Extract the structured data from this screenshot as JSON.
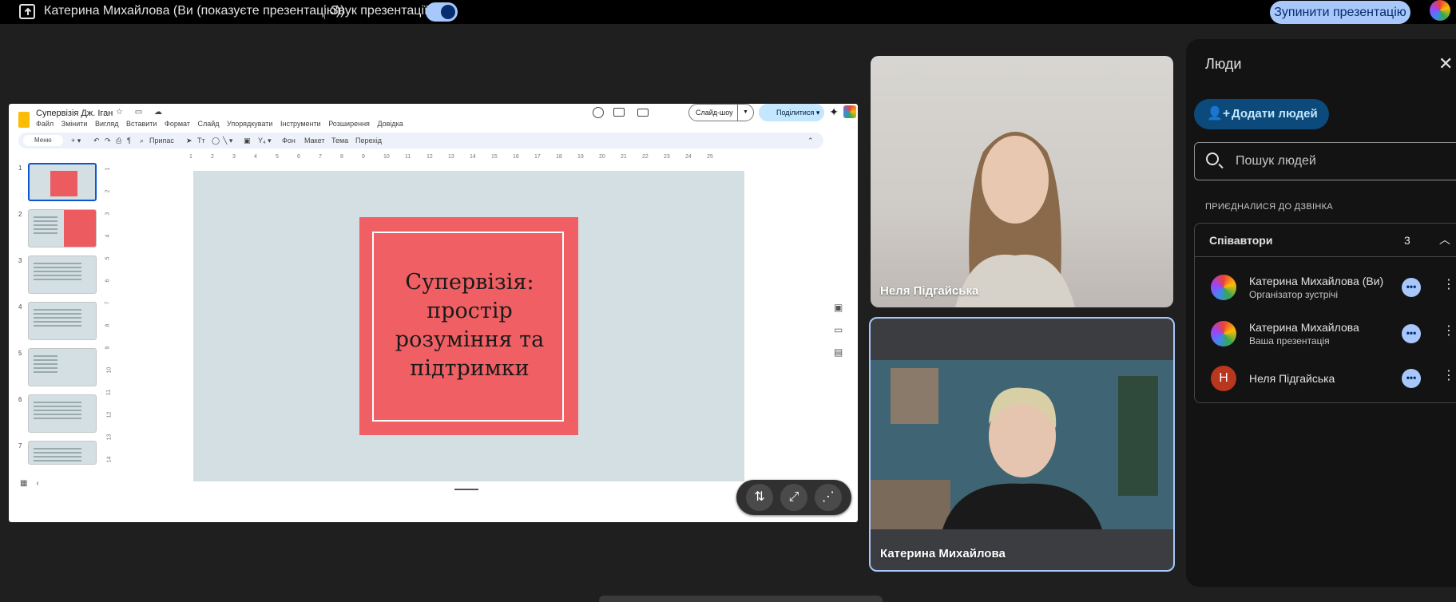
{
  "topbar": {
    "presenter_title": "Катерина Михайлова (Ви (показуєте презентацію))",
    "audio_label": "Звук презентації",
    "stop_button": "Зупинити презентацію"
  },
  "slides_app": {
    "doc_title": "Супервізія Дж. Іган",
    "menu": [
      "Файл",
      "Змінити",
      "Вигляд",
      "Вставити",
      "Формат",
      "Слайд",
      "Упорядкувати",
      "Інструменти",
      "Розширення",
      "Довідка"
    ],
    "slideshow_label": "Слайд-шоу",
    "share_label": "Поділитися",
    "toolbar": {
      "search": "Меню",
      "zoom": "Припас",
      "background": "Фон",
      "layout": "Макет",
      "theme": "Тема",
      "transition": "Перехід"
    },
    "ruler_h": [
      "1",
      "2",
      "3",
      "4",
      "5",
      "6",
      "7",
      "8",
      "9",
      "10",
      "11",
      "12",
      "13",
      "14",
      "15",
      "16",
      "17",
      "18",
      "19",
      "20",
      "21",
      "22",
      "23",
      "24",
      "25"
    ],
    "ruler_v": [
      "1",
      "2",
      "3",
      "4",
      "5",
      "6",
      "7",
      "8",
      "9",
      "10",
      "11",
      "12",
      "13",
      "14"
    ],
    "slide_numbers": [
      "1",
      "2",
      "3",
      "4",
      "5",
      "6",
      "7"
    ],
    "current_slide_title": "Супервізія: простір розуміння та підтримки",
    "colors": {
      "slide_bg": "#d3dfe3",
      "slide_accent": "#ef5f63"
    }
  },
  "participants": [
    {
      "name": "Неля Підгайська"
    },
    {
      "name": "Катерина Михайлова"
    }
  ],
  "people_panel": {
    "title": "Люди",
    "add_button": "Додати людей",
    "search_placeholder": "Пошук людей",
    "section_label": "ПРИЄДНАЛИСЯ ДО ДЗВІНКА",
    "group_name": "Співавтори",
    "group_count": "3",
    "people": [
      {
        "name": "Катерина Михайлова (Ви)",
        "subtitle": "Організатор зустрічі"
      },
      {
        "name": "Катерина Михайлова",
        "subtitle": "Ваша презентація"
      },
      {
        "name": "Неля Підгайська",
        "subtitle": "",
        "initial": "Н"
      }
    ]
  },
  "icons": {
    "present": "present-screen-icon",
    "audio": "volume-icon",
    "close": "close-icon",
    "add_person": "add-person-icon",
    "search": "search-icon",
    "more": "more-options-icon",
    "kebab": "kebab-menu-icon",
    "swap": "swap-layout-icon",
    "fullscreen": "fullscreen-icon",
    "share": "share-icon"
  }
}
